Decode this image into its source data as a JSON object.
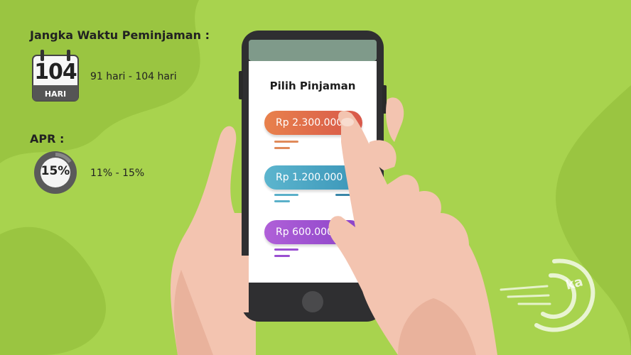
{
  "loan_term": {
    "heading": "Jangka Waktu Peminjaman :",
    "calendar_number": "104",
    "calendar_unit": "HARI",
    "range": "91 hari - 104 hari"
  },
  "apr": {
    "heading": "APR :",
    "gauge_value": "15%",
    "gauge_fraction": 0.15,
    "range": "11% - 15%"
  },
  "phone_screen": {
    "title": "Pilih Pinjaman",
    "options": [
      {
        "label": "Rp 2.300.000",
        "color": "#e06a43"
      },
      {
        "label": "Rp 1.200.000",
        "color": "#4aa9c4"
      },
      {
        "label": "Rp 600.000",
        "color": "#9a4fd1"
      }
    ]
  },
  "colors": {
    "background": "#a8d34e",
    "background_dark": "#97c13f",
    "phone_body": "#2f2f31",
    "skin": "#f3c4b0"
  },
  "icons": {
    "calendar": "calendar-icon",
    "gauge": "percentage-donut-icon",
    "watermark": "logo-watermark-icon"
  }
}
